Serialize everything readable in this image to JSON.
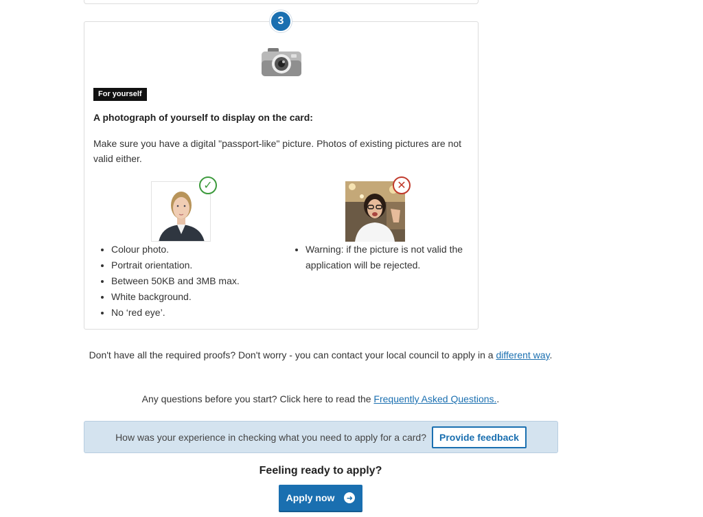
{
  "step": {
    "number": "3"
  },
  "card": {
    "tag": "For yourself",
    "heading": "A photograph of yourself to display on the card:",
    "description": "Make sure you have a digital \"passport-like\" picture. Photos of existing pictures are not valid either.",
    "good_icon": "check-icon",
    "bad_icon": "cross-icon",
    "requirements": [
      "Colour photo.",
      "Portrait orientation.",
      "Between 50KB and 3MB max.",
      "White background.",
      "No ‘red eye’."
    ],
    "warning": "Warning: if the picture is not valid the application will be rejected."
  },
  "help": {
    "prefix": "Don't have all the required proofs? Don't worry - you can contact your local council to apply in a ",
    "link": "different way",
    "suffix": "."
  },
  "faq": {
    "prefix": "Any questions before you start? Click here to read the ",
    "link": "Frequently Asked Questions.",
    "suffix": "."
  },
  "feedback": {
    "question": "How was your experience in checking what you need to apply for a card?",
    "button": "Provide feedback"
  },
  "apply": {
    "heading": "Feeling ready to apply?",
    "button": "Apply now"
  },
  "colors": {
    "primary": "#1a6fb0",
    "ok": "#3c9a3c",
    "error": "#c0392b",
    "feedback_bg": "#d4e3ef"
  }
}
